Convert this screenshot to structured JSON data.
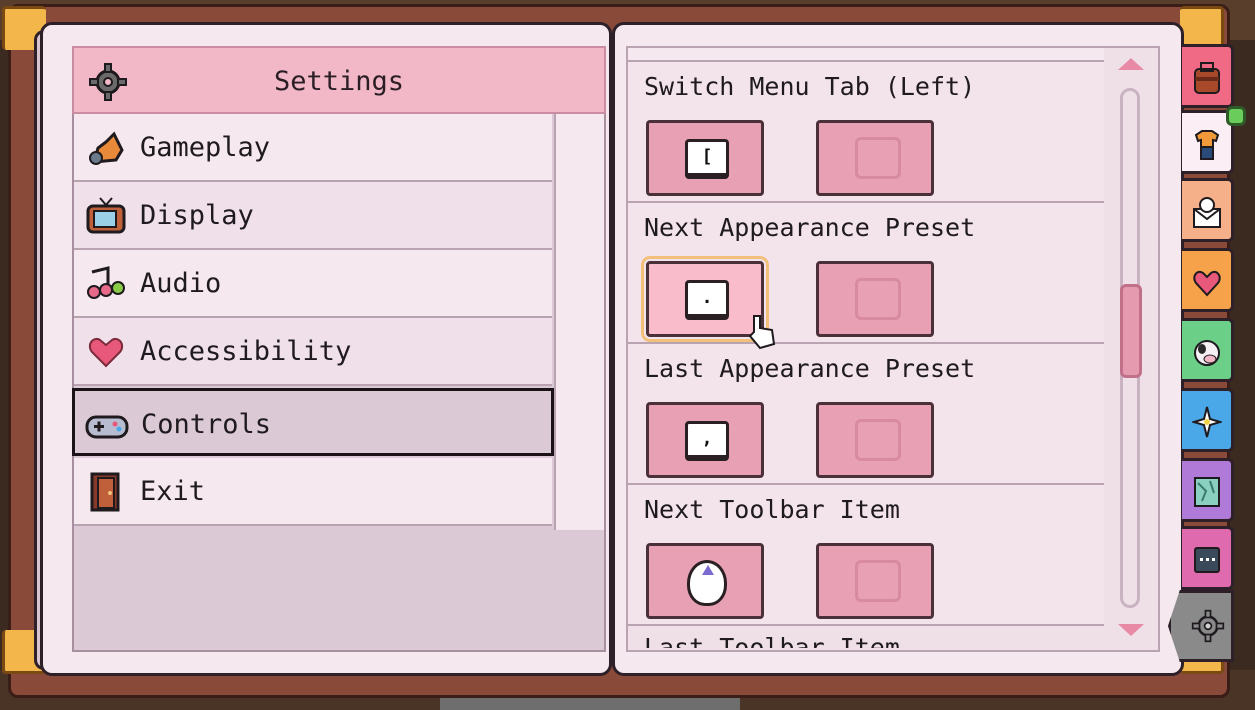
{
  "left_page": {
    "header": {
      "title": "Settings",
      "icon": "gear-icon"
    },
    "menu": [
      {
        "label": "Gameplay",
        "icon": "fox-icon"
      },
      {
        "label": "Display",
        "icon": "tv-icon"
      },
      {
        "label": "Audio",
        "icon": "music-note-icon"
      },
      {
        "label": "Accessibility",
        "icon": "heart-icon"
      },
      {
        "label": "Controls",
        "icon": "gamepad-icon",
        "selected": true
      },
      {
        "label": "Exit",
        "icon": "door-icon"
      }
    ]
  },
  "right_page": {
    "bindings": [
      {
        "label": "Switch Menu Tab (Left)",
        "primary": "[",
        "secondary": ""
      },
      {
        "label": "Next Appearance Preset",
        "primary": ".",
        "secondary": "",
        "focused": true
      },
      {
        "label": "Last Appearance Preset",
        "primary": ",",
        "secondary": ""
      },
      {
        "label": "Next Toolbar Item",
        "primary": "mouse-wheel-up",
        "secondary": ""
      }
    ],
    "partial_label": "Last Toolbar Item"
  },
  "side_tabs": [
    {
      "name": "backpack",
      "color": "#f06a86"
    },
    {
      "name": "wardrobe",
      "color": "#fbeef4",
      "badge": true
    },
    {
      "name": "mail",
      "color": "#f5b08a"
    },
    {
      "name": "relationships",
      "color": "#f5a24a"
    },
    {
      "name": "animals",
      "color": "#6ccf88"
    },
    {
      "name": "skills",
      "color": "#4aa8e8"
    },
    {
      "name": "map",
      "color": "#b07ad8"
    },
    {
      "name": "journal",
      "color": "#e06aae"
    },
    {
      "name": "settings",
      "color": "#8a8a8a",
      "active": true
    }
  ],
  "colors": {
    "accent_pink": "#f2b8c8",
    "button_pink": "#e8a0b4",
    "focus_outline": "#f2c07a",
    "page_bg": "#f6e8ef"
  }
}
